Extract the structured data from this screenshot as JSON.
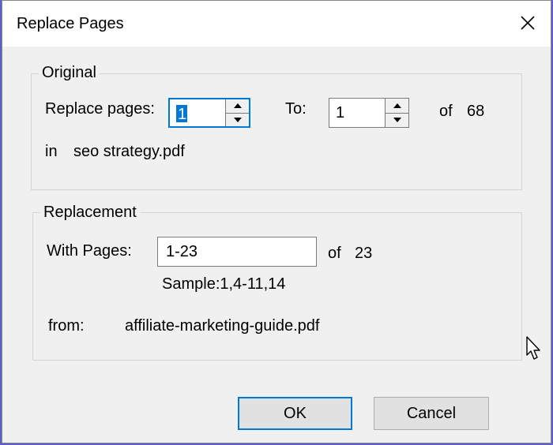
{
  "dialog": {
    "title": "Replace Pages",
    "close_icon": "close-icon"
  },
  "original": {
    "group_title": "Original",
    "replace_pages_label": "Replace pages:",
    "from_value": "1",
    "to_label": "To:",
    "to_value": "1",
    "of_label": "of",
    "total_pages": "68",
    "in_label": "in",
    "file_name": "seo strategy.pdf"
  },
  "replacement": {
    "group_title": "Replacement",
    "with_pages_label": "With Pages:",
    "pages_value": "1-23",
    "of_label": "of",
    "total_pages": "23",
    "sample_text": "Sample:1,4-11,14",
    "from_label": "from:",
    "file_name": "affiliate-marketing-guide.pdf"
  },
  "buttons": {
    "ok_label": "OK",
    "cancel_label": "Cancel"
  }
}
